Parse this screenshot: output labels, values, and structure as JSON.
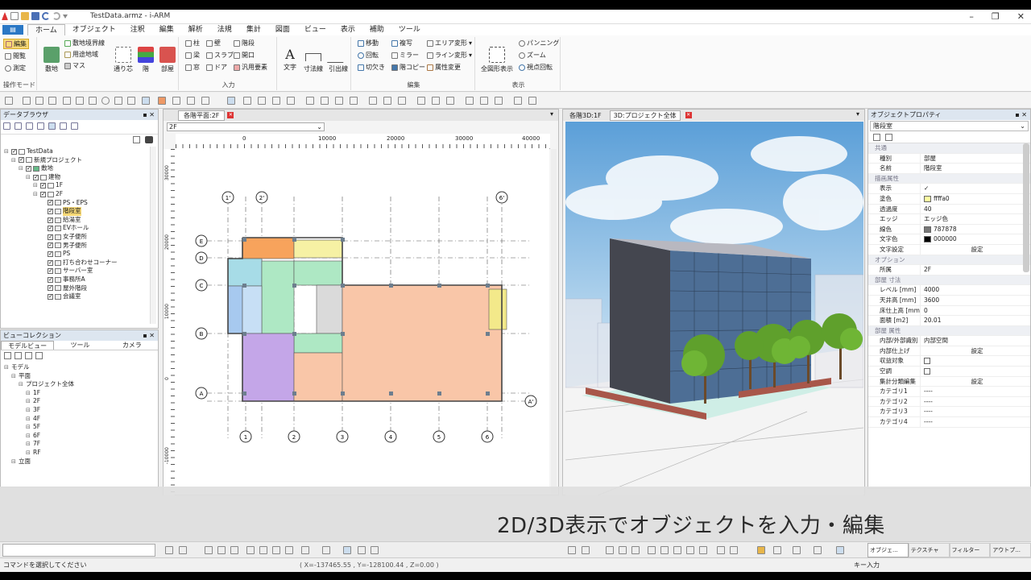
{
  "app": {
    "title": "TestData.armz - i-ARM"
  },
  "menu": {
    "file": "",
    "tabs": [
      "ホーム",
      "オブジェクト",
      "注釈",
      "編集",
      "解析",
      "法規",
      "集計",
      "図面",
      "ビュー",
      "表示",
      "補助",
      "ツール"
    ]
  },
  "ribbon": {
    "mode": {
      "edit": "編集",
      "browse": "閲覧",
      "measure": "測定",
      "label": "操作モード"
    },
    "site": {
      "site": "敷地",
      "boundary": "敷地境界線",
      "zoning": "用途地域",
      "mass": "マス",
      "fit": "通り芯",
      "floor": "階",
      "room": "部屋"
    },
    "input": {
      "column": "柱",
      "wall": "壁",
      "stair": "階段",
      "beam": "梁",
      "slab": "スラブ",
      "opening": "開口",
      "window": "窓",
      "door": "ドア",
      "generic": "汎用要素",
      "label": "入力"
    },
    "text": {
      "text": "文字",
      "dim": "寸法線",
      "leader": "引出線"
    },
    "edit": {
      "move": "移動",
      "copy": "複写",
      "area_deform": "エリア変形",
      "rotate": "回転",
      "mirror": "ミラー",
      "line_deform": "ライン変形",
      "cut": "切欠き",
      "floor_copy": "階コピー",
      "attr_change": "属性変更",
      "label": "編集"
    },
    "view": {
      "fit_all": "全図形表示",
      "pan": "パンニング",
      "zoom": "ズーム",
      "orbit": "視点回転",
      "label": "表示"
    }
  },
  "data_browser": {
    "title": "データブラウザ",
    "tree": [
      {
        "label": "TestData",
        "level": 0
      },
      {
        "label": "新規プロジェクト",
        "level": 1
      },
      {
        "label": "敷地",
        "level": 2
      },
      {
        "label": "建物",
        "level": 3
      },
      {
        "label": "1F",
        "level": 4
      },
      {
        "label": "2F",
        "level": 4
      },
      {
        "label": "PS・EPS",
        "level": 5
      },
      {
        "label": "階段室",
        "level": 5,
        "selected": true
      },
      {
        "label": "給湯室",
        "level": 5
      },
      {
        "label": "EVホール",
        "level": 5
      },
      {
        "label": "女子便所",
        "level": 5
      },
      {
        "label": "男子便所",
        "level": 5
      },
      {
        "label": "PS",
        "level": 5
      },
      {
        "label": "打ち合わせコーナー",
        "level": 5
      },
      {
        "label": "サーバー室",
        "level": 5
      },
      {
        "label": "事務所A",
        "level": 5
      },
      {
        "label": "屋外階段",
        "level": 5
      },
      {
        "label": "会議室",
        "level": 5
      }
    ]
  },
  "view_collection": {
    "title": "ビューコレクション",
    "tabs": [
      "モデルビュー",
      "ツール",
      "カメラ"
    ],
    "tree": [
      {
        "label": "モデル",
        "level": 0
      },
      {
        "label": "平面",
        "level": 1
      },
      {
        "label": "プロジェクト全体",
        "level": 2
      },
      {
        "label": "1F",
        "level": 3
      },
      {
        "label": "2F",
        "level": 3
      },
      {
        "label": "3F",
        "level": 3
      },
      {
        "label": "4F",
        "level": 3
      },
      {
        "label": "5F",
        "level": 3
      },
      {
        "label": "6F",
        "level": 3
      },
      {
        "label": "7F",
        "level": 3
      },
      {
        "label": "RF",
        "level": 3
      },
      {
        "label": "立面",
        "level": 1
      }
    ]
  },
  "plan_view": {
    "tab": "各階平面:2F",
    "floor_select": "2F",
    "ruler_h": [
      "0",
      "10000",
      "20000",
      "30000",
      "40000"
    ],
    "ruler_v": [
      "30000",
      "20000",
      "10000",
      "0",
      "-10000"
    ],
    "grid_x": [
      "1",
      "2",
      "3",
      "4",
      "5",
      "6"
    ],
    "grid_x_top": [
      "1'",
      "2'",
      "6'"
    ],
    "grid_y": [
      "E",
      "D",
      "C",
      "B",
      "A"
    ],
    "grid_y_right": "A'"
  },
  "view3d": {
    "tab1": "各階3D:1F",
    "tab2": "3D:プロジェクト全体"
  },
  "properties": {
    "title": "オブジェクトプロパティ",
    "object": "階段室",
    "groups": [
      {
        "name": "共通",
        "rows": [
          {
            "k": "種別",
            "v": "部屋"
          },
          {
            "k": "名前",
            "v": "階段室"
          }
        ]
      },
      {
        "name": "描画属性",
        "rows": [
          {
            "k": "表示",
            "v": "✓"
          },
          {
            "k": "塗色",
            "v": "ffffa0",
            "swatch": "#ffffa0"
          },
          {
            "k": "透過度",
            "v": "40"
          },
          {
            "k": "エッジ",
            "v": "エッジ色"
          },
          {
            "k": "線色",
            "v": "787878",
            "swatch": "#787878"
          },
          {
            "k": "文字色",
            "v": "000000",
            "swatch": "#000000"
          },
          {
            "k": "文字設定",
            "v": "設定"
          }
        ]
      },
      {
        "name": "オプション",
        "rows": [
          {
            "k": "所属",
            "v": "2F"
          }
        ]
      },
      {
        "name": "部屋 寸法",
        "rows": [
          {
            "k": "レベル [mm]",
            "v": "4000"
          },
          {
            "k": "天井高 [mm]",
            "v": "3600"
          },
          {
            "k": "床仕上高 [mm]",
            "v": "0"
          },
          {
            "k": "面積 [m2]",
            "v": "20.01"
          }
        ]
      },
      {
        "name": "部屋 属性",
        "rows": [
          {
            "k": "内部/外部識別",
            "v": "内部空間"
          },
          {
            "k": "内部仕上げ",
            "v": "設定"
          },
          {
            "k": "収益対象",
            "v": ""
          },
          {
            "k": "空調",
            "v": ""
          },
          {
            "k": "集計分類編集",
            "v": "設定"
          },
          {
            "k": "カテゴリ1",
            "v": "----"
          },
          {
            "k": "カテゴリ2",
            "v": "----"
          },
          {
            "k": "カテゴリ3",
            "v": "----"
          },
          {
            "k": "カテゴリ4",
            "v": "----"
          }
        ]
      }
    ],
    "bottom_tabs": [
      "オブジェ...",
      "テクスチャ",
      "フィルター",
      "アウトプ..."
    ]
  },
  "caption": "2D/3D表示でオブジェクトを入力・編集",
  "status": {
    "hint": "コマンドを選択してください",
    "coords": "( X=-137465.55 , Y=-128100.44 , Z=0.00 )",
    "key_input": "キー入力"
  },
  "colors": {
    "accent": "#2b78c5",
    "selected": "#f7d977"
  }
}
